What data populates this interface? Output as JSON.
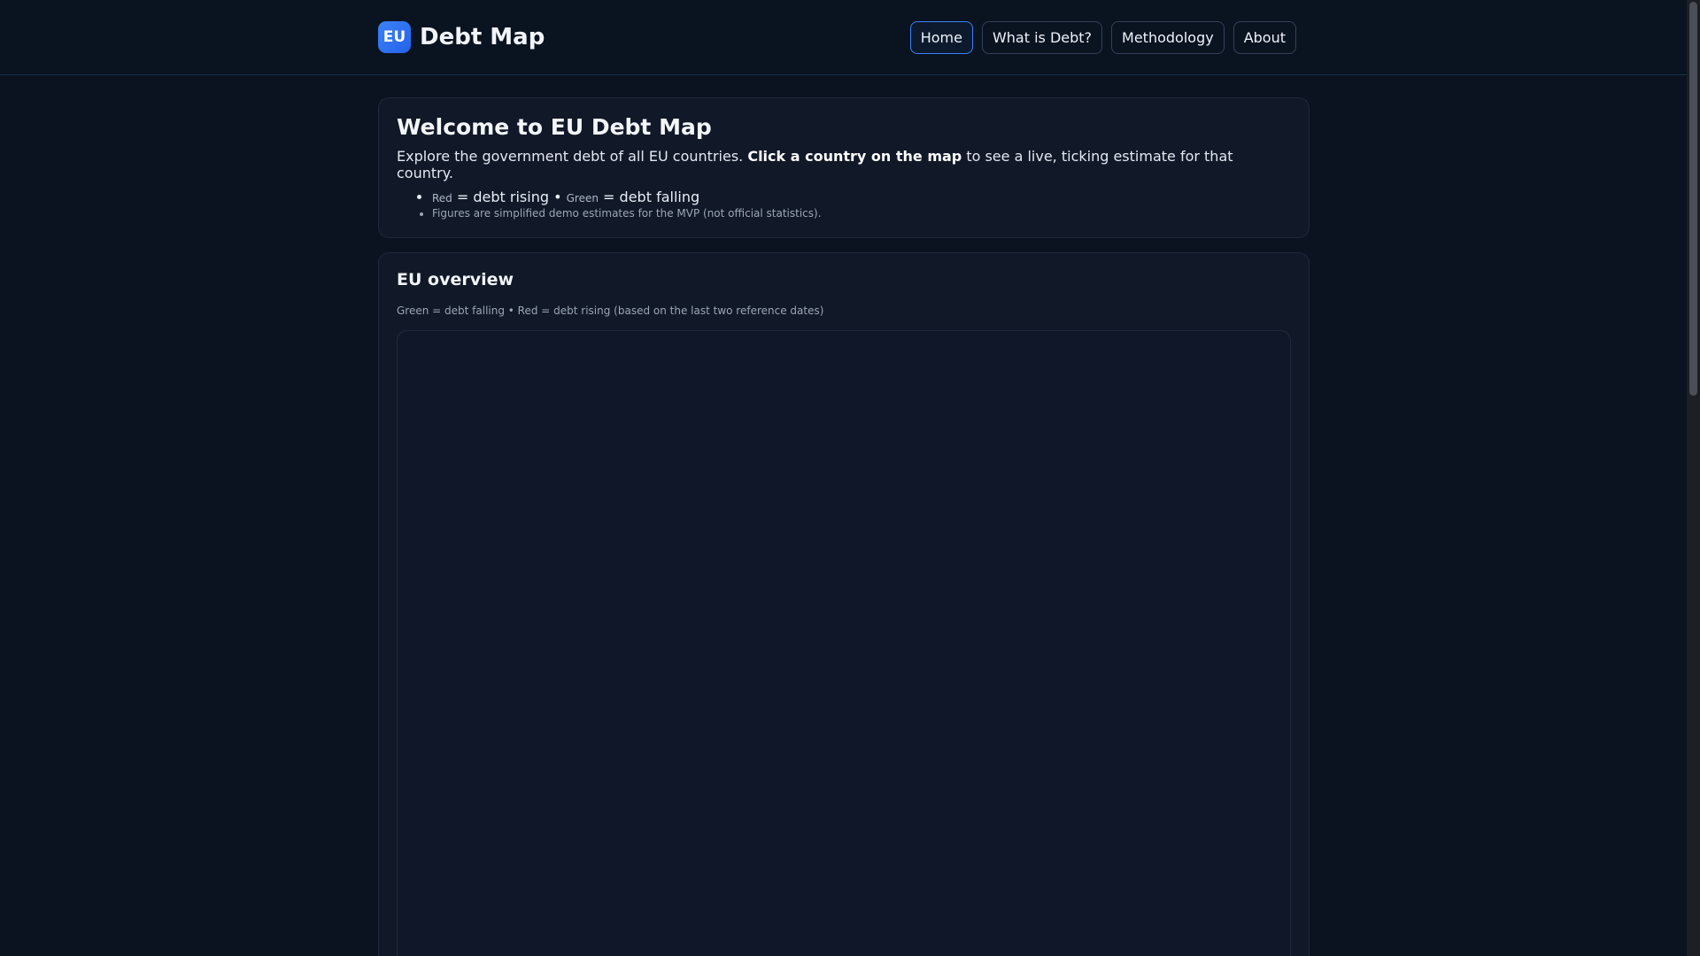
{
  "header": {
    "badge": "EU",
    "title": "Debt Map",
    "nav": [
      "Home",
      "What is Debt?",
      "Methodology",
      "About"
    ],
    "active_nav": "Home"
  },
  "welcome": {
    "title": "Welcome to EU Debt Map",
    "text_before": "Explore the government debt of all EU countries. ",
    "text_bold": "Click a country on the map",
    "text_after": " to see a live, ticking estimate for that country.",
    "legend_red_word": "Red",
    "legend_red_text": " = debt rising • ",
    "legend_green_word": "Green",
    "legend_green_text": " = debt falling",
    "note": "Figures are simplified demo estimates for the MVP (not official statistics)."
  },
  "overview": {
    "title": "EU overview",
    "subtitle": "Green = debt falling • Red = debt rising (based on the last two reference dates)"
  },
  "colors": {
    "background": "#0b1220",
    "card": "#111827",
    "accent": "#3b82f6"
  }
}
